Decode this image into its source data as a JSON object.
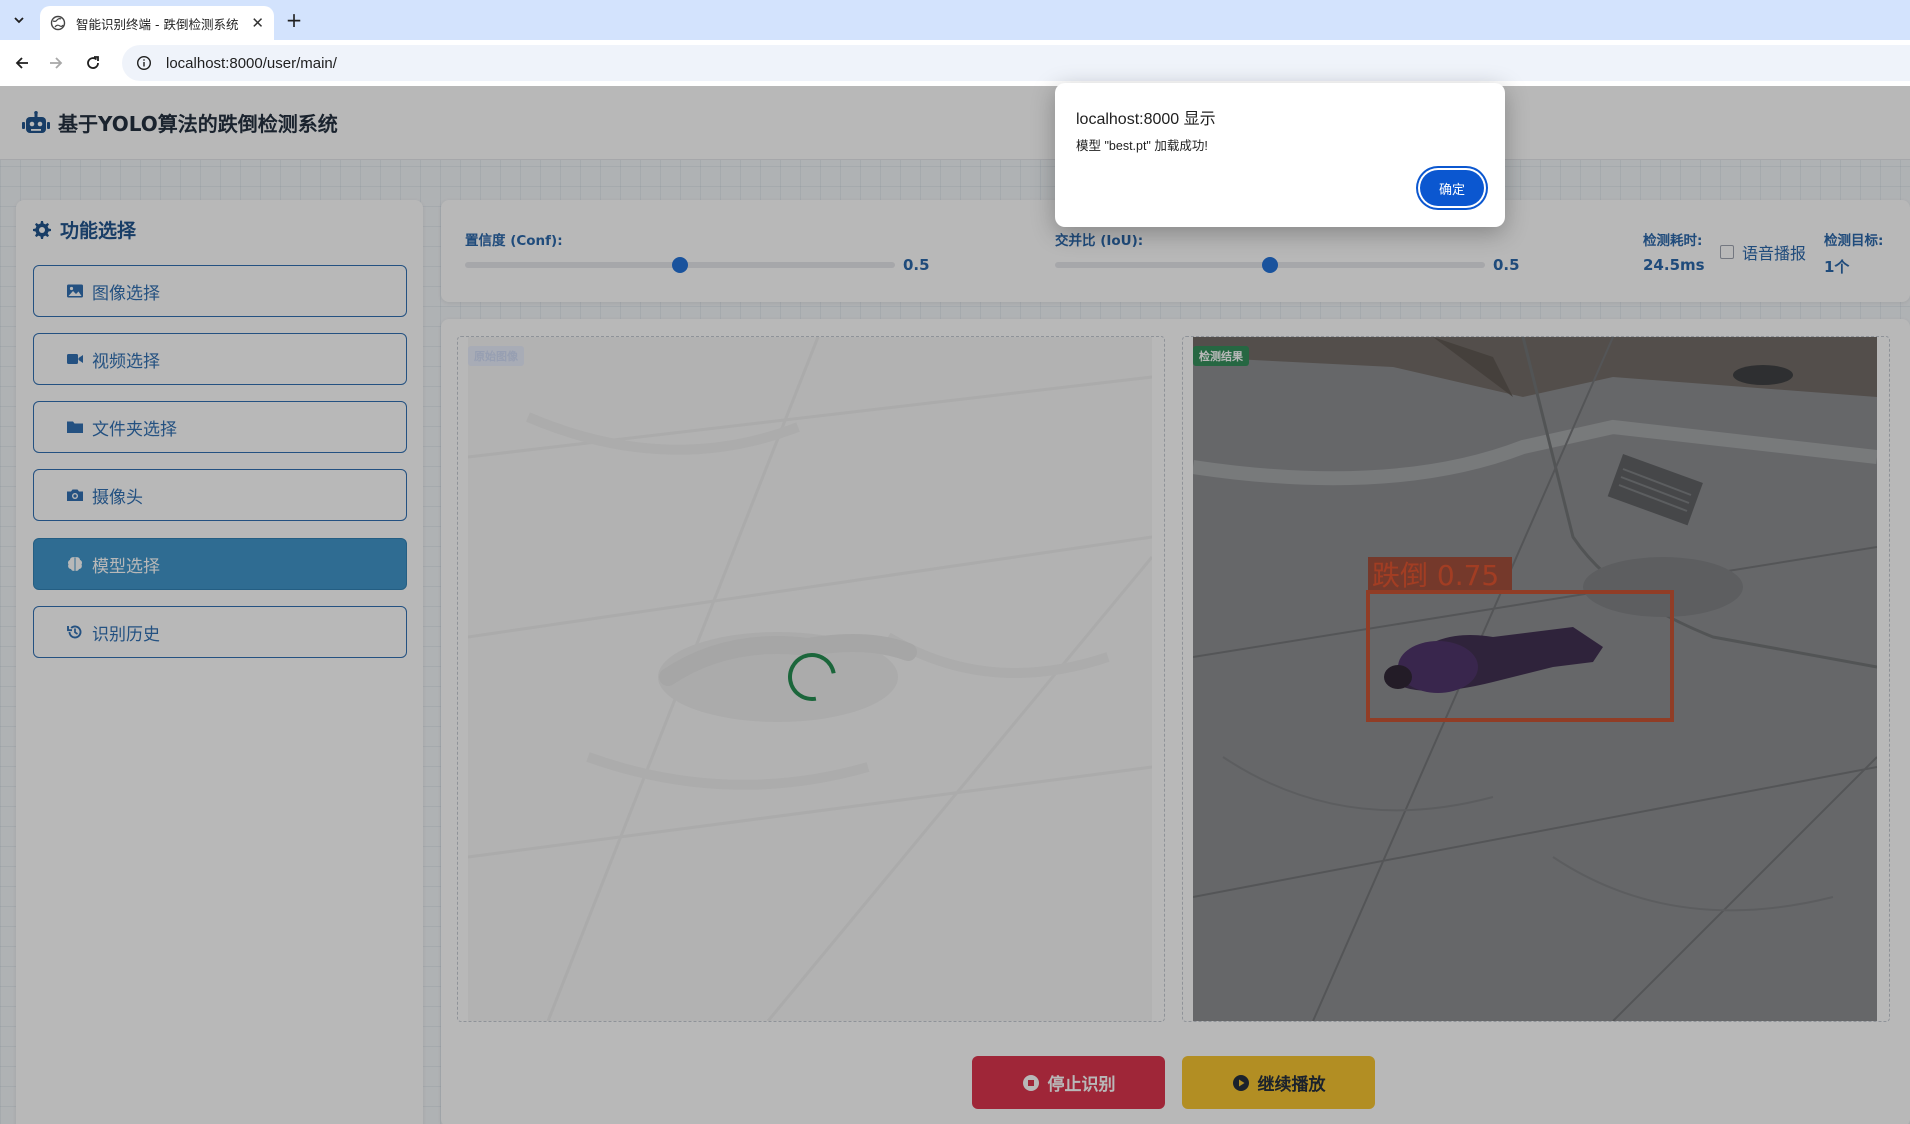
{
  "browser": {
    "tab_title": "智能识别终端 - 跌倒检测系统",
    "url": "localhost:8000/user/main/"
  },
  "app": {
    "title": "基于YOLO算法的跌倒检测系统"
  },
  "sidebar": {
    "title": "功能选择",
    "items": [
      {
        "label": "图像选择",
        "icon": "image-icon",
        "active": false
      },
      {
        "label": "视频选择",
        "icon": "video-icon",
        "active": false
      },
      {
        "label": "文件夹选择",
        "icon": "folder-icon",
        "active": false
      },
      {
        "label": "摄像头",
        "icon": "camera-icon",
        "active": false
      },
      {
        "label": "模型选择",
        "icon": "brain-icon",
        "active": true
      },
      {
        "label": "识别历史",
        "icon": "history-icon",
        "active": false
      }
    ]
  },
  "controls": {
    "conf_label": "置信度 (Conf):",
    "conf_value": "0.5",
    "conf_level": 0.5,
    "iou_label": "交并比 (IoU):",
    "iou_value": "0.5",
    "iou_level": 0.5,
    "time_label": "检测耗时:",
    "time_value": "24.5ms",
    "voice_label": "语音播报",
    "voice_checked": false,
    "target_label": "检测目标:",
    "target_value": "1个"
  },
  "panes": {
    "original_badge": "原始图像",
    "result_badge": "检测结果",
    "detection_label": "跌倒 0.75"
  },
  "actions": {
    "stop_label": "停止识别",
    "resume_label": "继续播放"
  },
  "dialog": {
    "title": "localhost:8000 显示",
    "message": "模型 \"best.pt\" 加载成功!",
    "ok_label": "确定"
  },
  "colors": {
    "accent": "#2b6cb0",
    "active_menu": "#3b93c9",
    "stop": "#dc2f48",
    "resume": "#f6c32a",
    "detection_box": "#e0502a",
    "dialog_button": "#0b57d0"
  }
}
